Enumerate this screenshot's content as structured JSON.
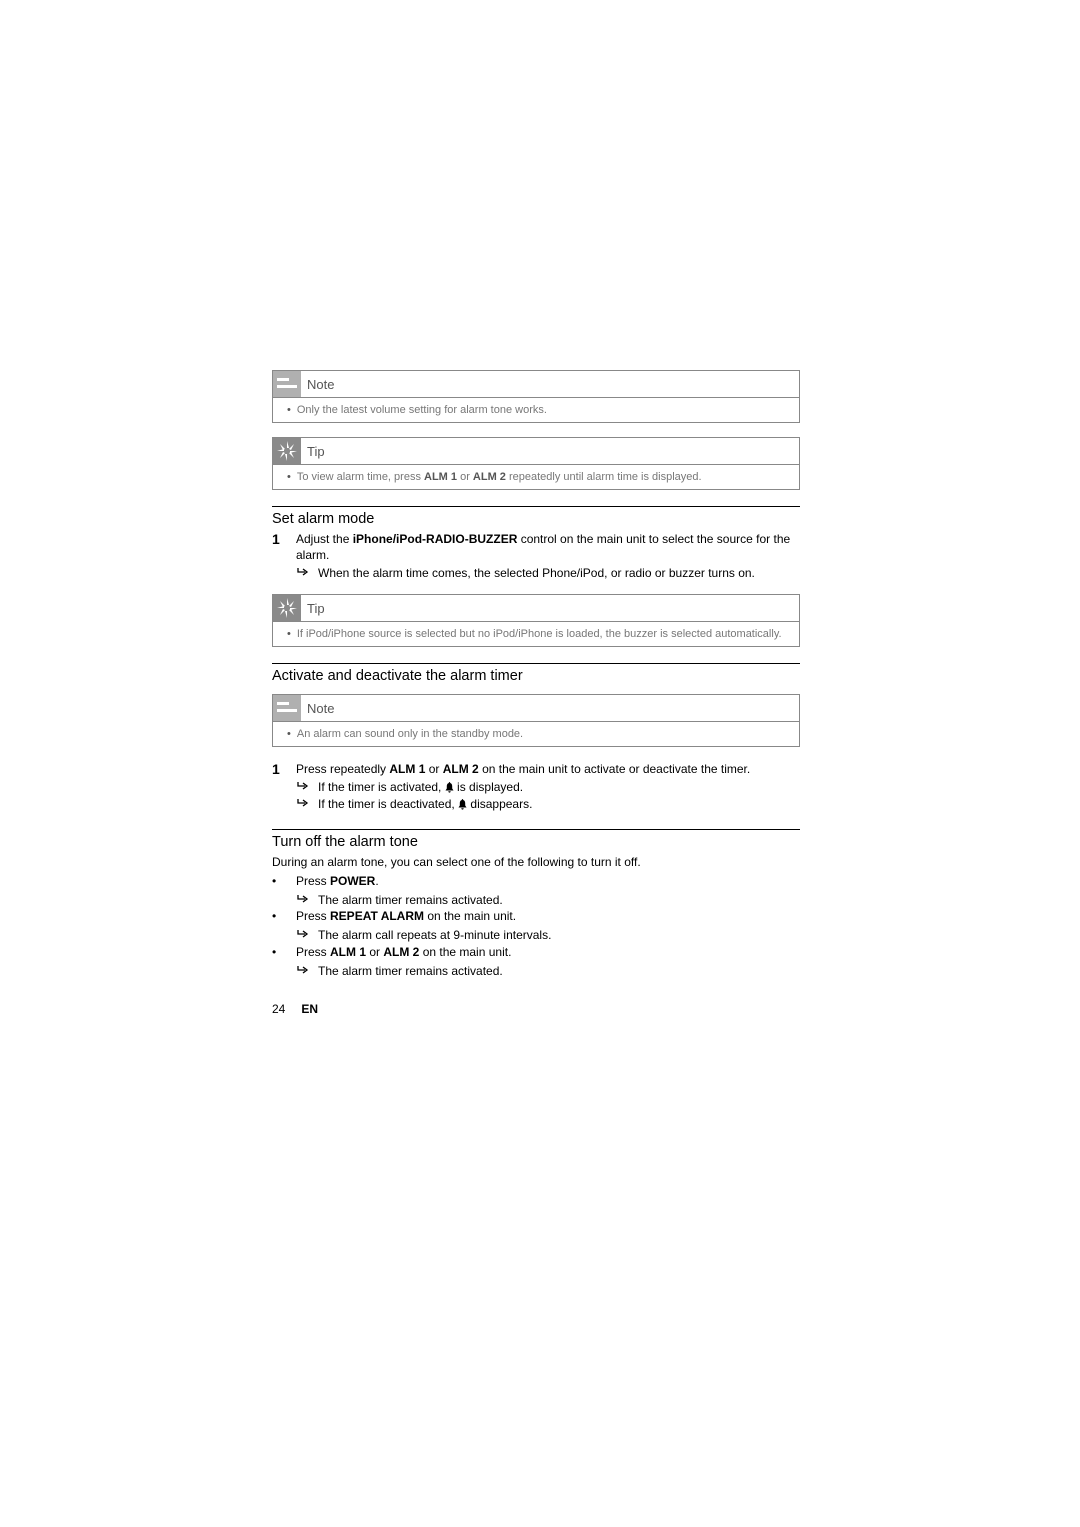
{
  "callouts": {
    "note1": {
      "title": "Note",
      "item": "Only the latest volume setting for alarm tone works."
    },
    "tip1": {
      "title": "Tip",
      "item_pre": "To view alarm time, press ",
      "alm1": "ALM 1",
      "item_mid": " or ",
      "alm2": "ALM 2",
      "item_post": " repeatedly until alarm time is displayed."
    },
    "tip2": {
      "title": "Tip",
      "item": "If iPod/iPhone source is selected but no iPod/iPhone is loaded, the buzzer is selected automatically."
    },
    "note2": {
      "title": "Note",
      "item": "An alarm can sound only in the standby mode."
    }
  },
  "sections": {
    "set_alarm": {
      "heading": "Set alarm mode",
      "step_num": "1",
      "step_pre": "Adjust the ",
      "step_bold": "iPhone/iPod-RADIO-BUZZER",
      "step_post": " control on the main unit to select the source for the alarm.",
      "sub1": "When the alarm time comes, the selected Phone/iPod, or radio or buzzer turns on."
    },
    "activate": {
      "heading": "Activate and deactivate the alarm timer",
      "step_num": "1",
      "step_pre": "Press repeatedly ",
      "alm1": "ALM 1",
      "step_mid": " or ",
      "alm2": "ALM 2",
      "step_post": " on the main unit to activate or deactivate the timer.",
      "sub1_pre": "If the timer is activated, ",
      "sub1_post": " is displayed.",
      "sub2_pre": "If the timer is deactivated, ",
      "sub2_post": " disappears."
    },
    "turn_off": {
      "heading": "Turn off the alarm tone",
      "intro": "During an alarm tone, you can select one of the following to turn it off.",
      "b1_pre": "Press ",
      "b1_bold": "POWER",
      "b1_post": ".",
      "b1_sub": "The alarm timer remains activated.",
      "b2_pre": "Press ",
      "b2_bold": "REPEAT ALARM",
      "b2_post": " on the main unit.",
      "b2_sub": "The alarm call repeats at 9-minute intervals.",
      "b3_pre": "Press ",
      "b3_alm1": "ALM 1",
      "b3_mid": " or ",
      "b3_alm2": "ALM 2",
      "b3_post": " on the main unit.",
      "b3_sub": "The alarm timer remains activated."
    }
  },
  "footer": {
    "page": "24",
    "lang": "EN"
  }
}
